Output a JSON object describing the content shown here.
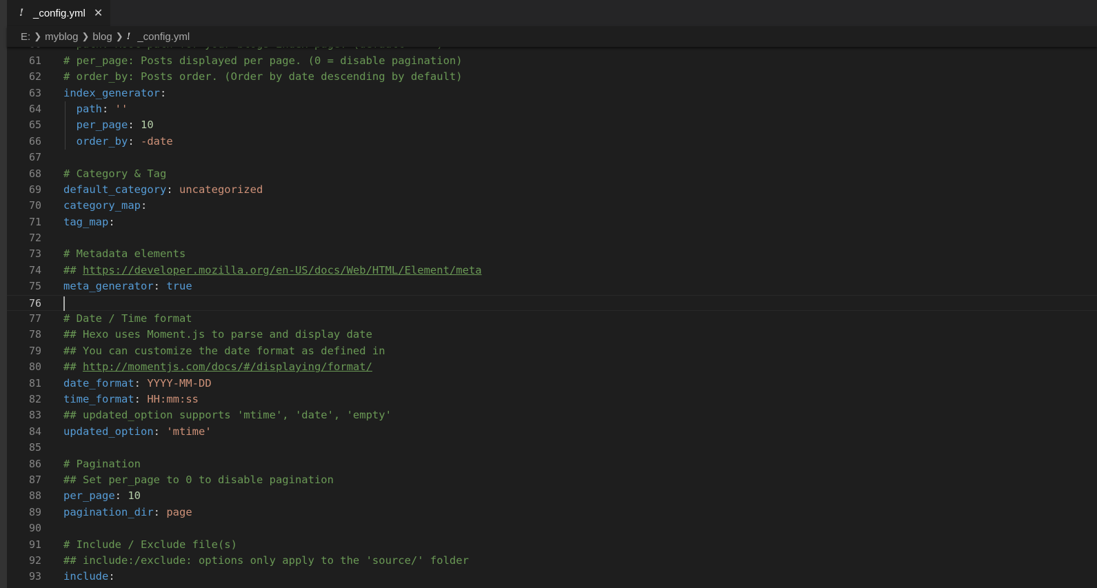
{
  "tab": {
    "label": "_config.yml",
    "icon": "yaml-exclamation-icon",
    "close_glyph": "✕"
  },
  "breadcrumb": {
    "items": [
      "E:",
      "myblog",
      "blog"
    ],
    "file": "_config.yml"
  },
  "editor": {
    "current_line": 76,
    "lines": [
      {
        "n": "60",
        "indent": 0,
        "parts": [
          {
            "t": "  path: Root path for your blogs index page. (default = '')",
            "c": "c"
          }
        ]
      },
      {
        "n": "61",
        "indent": 0,
        "parts": [
          {
            "t": "# per_page: Posts displayed per page. (0 = disable pagination)",
            "c": "c"
          }
        ]
      },
      {
        "n": "62",
        "indent": 0,
        "parts": [
          {
            "t": "# order_by: Posts order. (Order by date descending by default)",
            "c": "c"
          }
        ]
      },
      {
        "n": "63",
        "indent": 0,
        "parts": [
          {
            "t": "index_generator",
            "c": "k"
          },
          {
            "t": ":",
            "c": "p"
          }
        ]
      },
      {
        "n": "64",
        "indent": 1,
        "parts": [
          {
            "t": "  "
          },
          {
            "t": "path",
            "c": "k"
          },
          {
            "t": ": ",
            "c": "p"
          },
          {
            "t": "''",
            "c": "s"
          }
        ]
      },
      {
        "n": "65",
        "indent": 1,
        "parts": [
          {
            "t": "  "
          },
          {
            "t": "per_page",
            "c": "k"
          },
          {
            "t": ": ",
            "c": "p"
          },
          {
            "t": "10",
            "c": "n"
          }
        ]
      },
      {
        "n": "66",
        "indent": 1,
        "parts": [
          {
            "t": "  "
          },
          {
            "t": "order_by",
            "c": "k"
          },
          {
            "t": ": ",
            "c": "p"
          },
          {
            "t": "-date",
            "c": "s"
          }
        ]
      },
      {
        "n": "67",
        "indent": 0,
        "parts": []
      },
      {
        "n": "68",
        "indent": 0,
        "parts": [
          {
            "t": "# Category & Tag",
            "c": "c"
          }
        ]
      },
      {
        "n": "69",
        "indent": 0,
        "parts": [
          {
            "t": "default_category",
            "c": "k"
          },
          {
            "t": ": ",
            "c": "p"
          },
          {
            "t": "uncategorized",
            "c": "s"
          }
        ]
      },
      {
        "n": "70",
        "indent": 0,
        "parts": [
          {
            "t": "category_map",
            "c": "k"
          },
          {
            "t": ":",
            "c": "p"
          }
        ]
      },
      {
        "n": "71",
        "indent": 0,
        "parts": [
          {
            "t": "tag_map",
            "c": "k"
          },
          {
            "t": ":",
            "c": "p"
          }
        ]
      },
      {
        "n": "72",
        "indent": 0,
        "parts": []
      },
      {
        "n": "73",
        "indent": 0,
        "parts": [
          {
            "t": "# Metadata elements",
            "c": "c"
          }
        ]
      },
      {
        "n": "74",
        "indent": 0,
        "parts": [
          {
            "t": "## ",
            "c": "c"
          },
          {
            "t": "https://developer.mozilla.org/en-US/docs/Web/HTML/Element/meta",
            "c": "u"
          }
        ]
      },
      {
        "n": "75",
        "indent": 0,
        "parts": [
          {
            "t": "meta_generator",
            "c": "k"
          },
          {
            "t": ": ",
            "c": "p"
          },
          {
            "t": "true",
            "c": "b"
          }
        ]
      },
      {
        "n": "76",
        "indent": 0,
        "parts": []
      },
      {
        "n": "77",
        "indent": 0,
        "parts": [
          {
            "t": "# Date / Time format",
            "c": "c"
          }
        ]
      },
      {
        "n": "78",
        "indent": 0,
        "parts": [
          {
            "t": "## Hexo uses Moment.js to parse and display date",
            "c": "c"
          }
        ]
      },
      {
        "n": "79",
        "indent": 0,
        "parts": [
          {
            "t": "## You can customize the date format as defined in",
            "c": "c"
          }
        ]
      },
      {
        "n": "80",
        "indent": 0,
        "parts": [
          {
            "t": "## ",
            "c": "c"
          },
          {
            "t": "http://momentjs.com/docs/#/displaying/format/",
            "c": "u"
          }
        ]
      },
      {
        "n": "81",
        "indent": 0,
        "parts": [
          {
            "t": "date_format",
            "c": "k"
          },
          {
            "t": ": ",
            "c": "p"
          },
          {
            "t": "YYYY-MM-DD",
            "c": "s"
          }
        ]
      },
      {
        "n": "82",
        "indent": 0,
        "parts": [
          {
            "t": "time_format",
            "c": "k"
          },
          {
            "t": ": ",
            "c": "p"
          },
          {
            "t": "HH:mm:ss",
            "c": "s"
          }
        ]
      },
      {
        "n": "83",
        "indent": 0,
        "parts": [
          {
            "t": "## updated_option supports 'mtime', 'date', 'empty'",
            "c": "c"
          }
        ]
      },
      {
        "n": "84",
        "indent": 0,
        "parts": [
          {
            "t": "updated_option",
            "c": "k"
          },
          {
            "t": ": ",
            "c": "p"
          },
          {
            "t": "'mtime'",
            "c": "s"
          }
        ]
      },
      {
        "n": "85",
        "indent": 0,
        "parts": []
      },
      {
        "n": "86",
        "indent": 0,
        "parts": [
          {
            "t": "# Pagination",
            "c": "c"
          }
        ]
      },
      {
        "n": "87",
        "indent": 0,
        "parts": [
          {
            "t": "## Set per_page to 0 to disable pagination",
            "c": "c"
          }
        ]
      },
      {
        "n": "88",
        "indent": 0,
        "parts": [
          {
            "t": "per_page",
            "c": "k"
          },
          {
            "t": ": ",
            "c": "p"
          },
          {
            "t": "10",
            "c": "n"
          }
        ]
      },
      {
        "n": "89",
        "indent": 0,
        "parts": [
          {
            "t": "pagination_dir",
            "c": "k"
          },
          {
            "t": ": ",
            "c": "p"
          },
          {
            "t": "page",
            "c": "s"
          }
        ]
      },
      {
        "n": "90",
        "indent": 0,
        "parts": []
      },
      {
        "n": "91",
        "indent": 0,
        "parts": [
          {
            "t": "# Include / Exclude file(s)",
            "c": "c"
          }
        ]
      },
      {
        "n": "92",
        "indent": 0,
        "parts": [
          {
            "t": "## include:/exclude: options only apply to the 'source/' folder",
            "c": "c"
          }
        ]
      },
      {
        "n": "93",
        "indent": 0,
        "parts": [
          {
            "t": "include",
            "c": "k"
          },
          {
            "t": ":",
            "c": "p"
          }
        ]
      }
    ]
  }
}
